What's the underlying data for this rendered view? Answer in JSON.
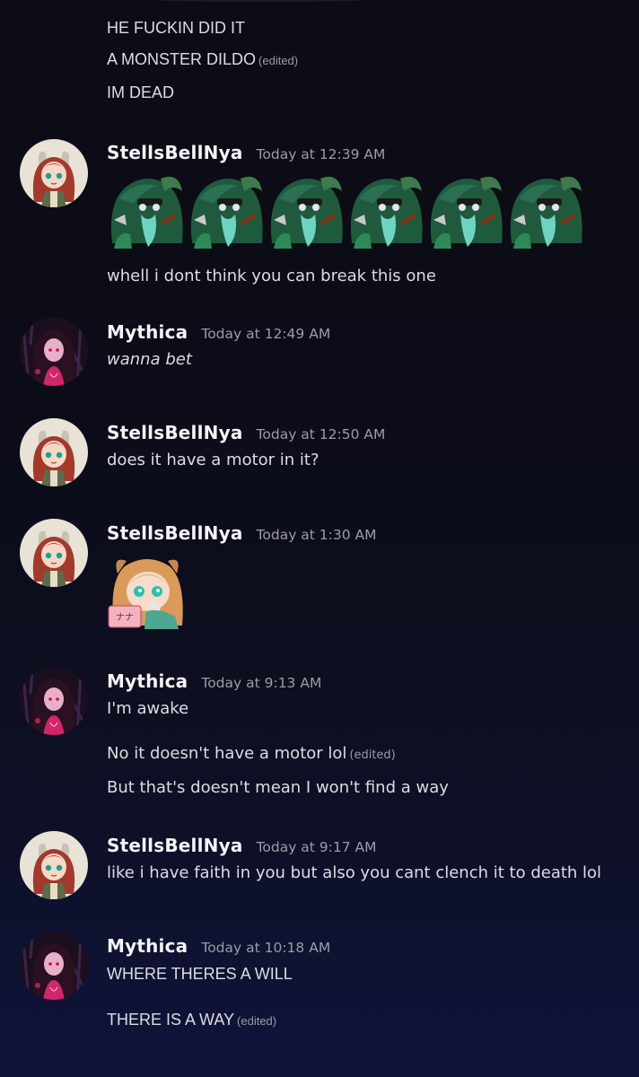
{
  "messages_top": [
    {
      "text": "HE FUCKIN DID IT",
      "edited": ""
    },
    {
      "text": "A MONSTER DILDO",
      "edited": "(edited)"
    },
    {
      "text": "IM DEAD",
      "edited": ""
    }
  ],
  "groups": [
    {
      "username": "StellsBellNya",
      "timestamp": "Today at 12:39 AM",
      "line1": "whell i dont think you can  break this one"
    },
    {
      "username": "Mythica",
      "timestamp": "Today at 12:49 AM",
      "line1": "wanna bet"
    },
    {
      "username": "StellsBellNya",
      "timestamp": "Today at 12:50 AM",
      "line1": "does it have a motor in it?"
    },
    {
      "username": "StellsBellNya",
      "timestamp": "Today at 1:30 AM"
    },
    {
      "username": "Mythica",
      "timestamp": "Today at 9:13 AM",
      "line1": "I'm awake",
      "line2": "No it doesn't have a motor lol",
      "line2_edited": "(edited)",
      "line3": "But that's doesn't mean I won't find a way"
    },
    {
      "username": "StellsBellNya",
      "timestamp": "Today at 9:17 AM",
      "line1": "like i have faith in you but also you cant clench it to death lol"
    },
    {
      "username": "Mythica",
      "timestamp": "Today at 10:18 AM",
      "line1": "WHERE THERES A WILL",
      "line2": "THERE IS A WAY",
      "line2_edited": "(edited)"
    }
  ],
  "sticker": {
    "label": "ナナ"
  },
  "icons": {
    "stells_avatar": "red-haired-girl-avatar-icon",
    "mythica_avatar": "dark-pink-girl-avatar-icon",
    "emoji": "green-haired-creature-emoji-icon"
  },
  "colors": {
    "background": "#0d0c14",
    "text": "#dcdde2",
    "muted": "#9a9ca6",
    "username": "#f3f4f6"
  }
}
